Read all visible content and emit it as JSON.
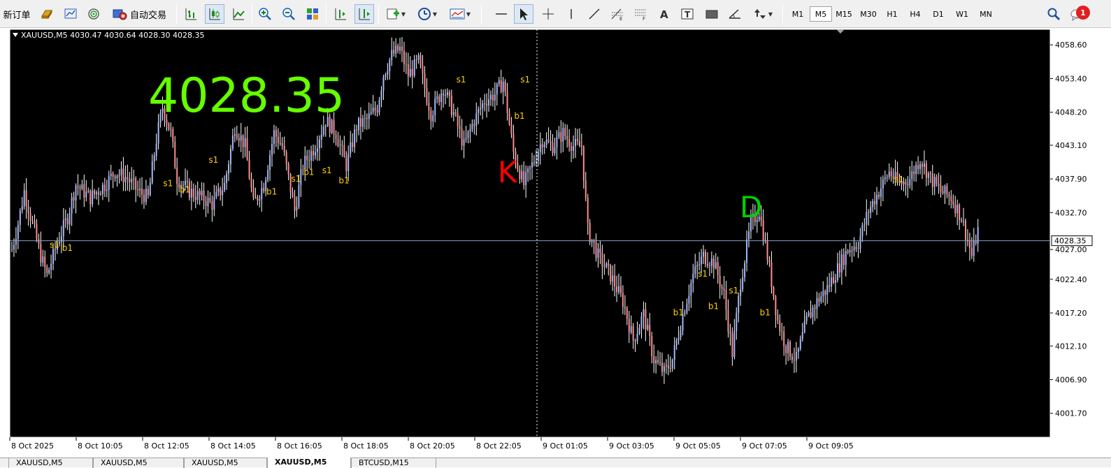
{
  "toolbar": {
    "new_order_label": "新订单",
    "auto_trading_label": "自动交易",
    "timeframes": [
      "M1",
      "M5",
      "M15",
      "M30",
      "H1",
      "H4",
      "D1",
      "W1",
      "MN"
    ],
    "active_timeframe": "M5",
    "notification_count": "1",
    "icons": [
      "gold-bars-icon",
      "market-watch-icon",
      "signals-icon",
      "autotrading-icon",
      "bar-chart-icon",
      "candlestick-icon",
      "line-chart-icon",
      "zoom-in-icon",
      "zoom-out-icon",
      "tile-windows-icon",
      "chart-shift-icon",
      "autoscroll-icon",
      "new-chart-icon",
      "periods-clock-icon",
      "templates-icon",
      "horizontal-line-icon",
      "cursor-arrow-icon",
      "crosshair-icon",
      "vertical-line-icon",
      "trend-line-icon",
      "fibonacci-icon",
      "fibonacci-expansion-icon",
      "text-icon",
      "text-label-icon",
      "rectangle-icon",
      "angle-icon",
      "arrows-icon",
      "search-icon",
      "notifications-icon"
    ]
  },
  "chart": {
    "symbol_header": "XAUUSD,M5  4030.47 4030.64 4028.30 4028.35",
    "big_price": "4028.35",
    "label_k": "K",
    "label_d": "D",
    "current_price_label": "4028.35",
    "colors": {
      "background": "#000000",
      "bull": "#a3b7ff",
      "bear": "#ff8c8c",
      "wick": "#ffffff",
      "big_price": "#66ff00",
      "signal": "#ffd200",
      "grid_axis": "#ffffff"
    }
  },
  "chart_data": {
    "type": "candlestick",
    "symbol": "XAUUSD",
    "timeframe": "M5",
    "ohlc_last": {
      "open": 4030.47,
      "high": 4030.64,
      "low": 4028.3,
      "close": 4028.35
    },
    "y_ticks": [
      "4058.60",
      "4053.40",
      "4048.20",
      "4043.10",
      "4037.90",
      "4032.70",
      "4027.00",
      "4022.40",
      "4017.20",
      "4012.10",
      "4006.90",
      "4001.70"
    ],
    "ylim": [
      3998.0,
      4061.0
    ],
    "x_ticks": [
      "8 Oct 2025",
      "8 Oct 10:05",
      "8 Oct 12:05",
      "8 Oct 14:05",
      "8 Oct 16:05",
      "8 Oct 18:05",
      "8 Oct 20:05",
      "8 Oct 22:05",
      "9 Oct 01:05",
      "9 Oct 03:05",
      "9 Oct 05:05",
      "9 Oct 07:05",
      "9 Oct 09:05"
    ],
    "current_price": 4028.35,
    "cursor_line_time": "9 Oct 01:05",
    "anchors": [
      [
        0,
        4027
      ],
      [
        3,
        4031
      ],
      [
        6,
        4036
      ],
      [
        10,
        4031
      ],
      [
        14,
        4026
      ],
      [
        17,
        4023
      ],
      [
        22,
        4028
      ],
      [
        27,
        4032
      ],
      [
        31,
        4037
      ],
      [
        38,
        4035
      ],
      [
        45,
        4037
      ],
      [
        50,
        4039
      ],
      [
        56,
        4038
      ],
      [
        61,
        4036
      ],
      [
        66,
        4035
      ],
      [
        70,
        4044
      ],
      [
        73,
        4049
      ],
      [
        77,
        4045
      ],
      [
        80,
        4038
      ],
      [
        86,
        4036
      ],
      [
        92,
        4035
      ],
      [
        97,
        4034
      ],
      [
        103,
        4037
      ],
      [
        108,
        4046
      ],
      [
        113,
        4043
      ],
      [
        117,
        4034
      ],
      [
        122,
        4037
      ],
      [
        127,
        4045
      ],
      [
        131,
        4043
      ],
      [
        137,
        4033
      ],
      [
        141,
        4040
      ],
      [
        147,
        4043
      ],
      [
        152,
        4047
      ],
      [
        157,
        4045
      ],
      [
        162,
        4040
      ],
      [
        167,
        4046
      ],
      [
        172,
        4047
      ],
      [
        177,
        4049
      ],
      [
        180,
        4054
      ],
      [
        184,
        4057
      ],
      [
        188,
        4058
      ],
      [
        192,
        4054
      ],
      [
        197,
        4056
      ],
      [
        203,
        4048
      ],
      [
        209,
        4052
      ],
      [
        214,
        4048
      ],
      [
        219,
        4043
      ],
      [
        224,
        4047
      ],
      [
        229,
        4050
      ],
      [
        234,
        4051
      ],
      [
        238,
        4053
      ],
      [
        243,
        4042
      ],
      [
        248,
        4037
      ],
      [
        252,
        4040
      ],
      [
        257,
        4044
      ],
      [
        262,
        4043
      ],
      [
        267,
        4045
      ],
      [
        272,
        4043
      ],
      [
        276,
        4043
      ],
      [
        279,
        4030
      ],
      [
        284,
        4026
      ],
      [
        290,
        4023
      ],
      [
        296,
        4019
      ],
      [
        301,
        4013
      ],
      [
        306,
        4017
      ],
      [
        311,
        4010
      ],
      [
        316,
        4008
      ],
      [
        320,
        4010
      ],
      [
        325,
        4017
      ],
      [
        330,
        4023
      ],
      [
        335,
        4026
      ],
      [
        340,
        4025
      ],
      [
        345,
        4020
      ],
      [
        349,
        4011
      ],
      [
        353,
        4022
      ],
      [
        358,
        4031
      ],
      [
        362,
        4033
      ],
      [
        366,
        4026
      ],
      [
        371,
        4016
      ],
      [
        375,
        4012
      ],
      [
        380,
        4010
      ],
      [
        385,
        4016
      ],
      [
        390,
        4019
      ],
      [
        395,
        4021
      ],
      [
        400,
        4024
      ],
      [
        405,
        4027
      ],
      [
        410,
        4028
      ],
      [
        415,
        4033
      ],
      [
        420,
        4036
      ],
      [
        425,
        4039
      ],
      [
        430,
        4037
      ],
      [
        435,
        4038
      ],
      [
        440,
        4041
      ],
      [
        445,
        4038
      ],
      [
        450,
        4036
      ],
      [
        455,
        4035
      ],
      [
        460,
        4032
      ],
      [
        465,
        4026
      ],
      [
        468,
        4030
      ]
    ],
    "signal_labels": [
      {
        "text": "s1",
        "x": 20,
        "y": 4027.3
      },
      {
        "text": "b1",
        "x": 26,
        "y": 4026.8
      },
      {
        "text": "s1",
        "x": 75,
        "y": 4036.8
      },
      {
        "text": "b1",
        "x": 83,
        "y": 4035.8
      },
      {
        "text": "s1",
        "x": 97,
        "y": 4040.4
      },
      {
        "text": "b1",
        "x": 125,
        "y": 4035.5
      },
      {
        "text": "s1",
        "x": 137,
        "y": 4037.5
      },
      {
        "text": "b1",
        "x": 143,
        "y": 4038.5
      },
      {
        "text": "s1",
        "x": 152,
        "y": 4038.8
      },
      {
        "text": "b1",
        "x": 160,
        "y": 4037.2
      },
      {
        "text": "s1",
        "x": 217,
        "y": 4052.8
      },
      {
        "text": "b1",
        "x": 245,
        "y": 4047.2
      },
      {
        "text": "s1",
        "x": 248,
        "y": 4052.8
      },
      {
        "text": "b1",
        "x": 322,
        "y": 4016.8
      },
      {
        "text": "s1",
        "x": 334,
        "y": 4022.8
      },
      {
        "text": "b1",
        "x": 339,
        "y": 4017.8
      },
      {
        "text": "s1",
        "x": 349,
        "y": 4020.2
      },
      {
        "text": "b1",
        "x": 364,
        "y": 4016.8
      },
      {
        "text": "s1",
        "x": 429,
        "y": 4037.4
      }
    ]
  },
  "tabs": [
    "XAUUSD,M5",
    "XAUUSD,M5",
    "XAUUSD,M5",
    "XAUUSD,M5",
    "BTCUSD,M15"
  ],
  "active_tab_index": 3
}
